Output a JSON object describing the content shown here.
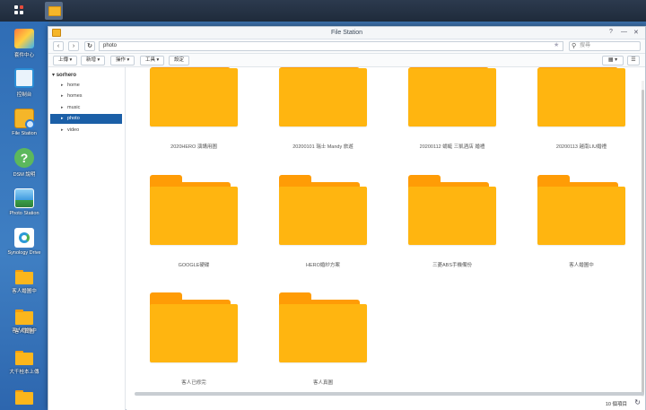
{
  "window": {
    "title": "File Station"
  },
  "desktop": {
    "icons": [
      {
        "label": "套件中心",
        "icon": "package-center-icon"
      },
      {
        "label": "控制台",
        "icon": "control-panel-icon"
      },
      {
        "label": "File Station",
        "icon": "file-station-icon"
      },
      {
        "label": "DSM 說明",
        "icon": "help-icon"
      },
      {
        "label": "Photo Station",
        "icon": "photo-station-icon"
      },
      {
        "label": "Synology Drive",
        "icon": "synology-drive-icon"
      },
      {
        "label": "客人婚圖中",
        "icon": "folder-icon"
      },
      {
        "label": "客人真圖",
        "icon": "folder-icon"
      },
      {
        "label": "大千桂本上傳",
        "icon": "folder-icon"
      }
    ]
  },
  "navbar": {
    "path": "photo",
    "search_placeholder": "搜尋"
  },
  "toolbar": {
    "upload": "上傳 ▾",
    "create": "新增 ▾",
    "action": "操作 ▾",
    "tools": "工具 ▾",
    "settings": "設定"
  },
  "tree": {
    "root": "sorhero",
    "nodes": [
      "home",
      "homes",
      "music",
      "photo",
      "video"
    ],
    "selected": "photo"
  },
  "folders": [
    "2020HERO 演講用圖",
    "20200101 瑞士 Mandy 旅遊",
    "20200112 蜻蜓 三凱酒店 婚禮",
    "20200113 越南LIU婚禮",
    "GOOGLE硬碟",
    "HERO婚紗方案",
    "三菱ABS手機備份",
    "客人婚圖中",
    "客人已修完",
    "客人真圖"
  ],
  "status": {
    "count": "10 個項目"
  },
  "colors": {
    "folder": "#ffb510",
    "folder_tab": "#ff9c06",
    "selection": "#1b5fa7"
  }
}
